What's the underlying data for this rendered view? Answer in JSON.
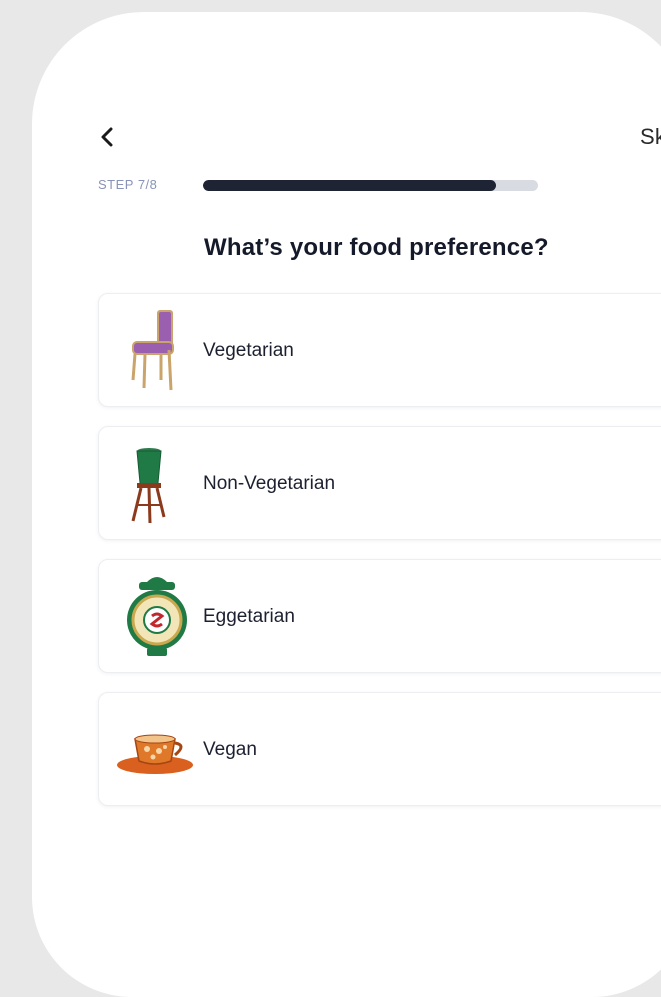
{
  "header": {
    "back_icon": "chevron-left-icon",
    "skip_label": "Skip"
  },
  "progress": {
    "step_label": "STEP 7/8",
    "fraction": 0.875
  },
  "question": "What’s your food preference?",
  "options": [
    {
      "label": "Vegetarian",
      "icon": "chair-icon"
    },
    {
      "label": "Non-Vegetarian",
      "icon": "plant-stand-icon"
    },
    {
      "label": "Eggetarian",
      "icon": "alarm-clock-icon"
    },
    {
      "label": "Vegan",
      "icon": "teacup-icon"
    }
  ],
  "colors": {
    "progress_fill": "#1f2435",
    "progress_track": "#d8dbe1",
    "step_label": "#8a93b8"
  }
}
